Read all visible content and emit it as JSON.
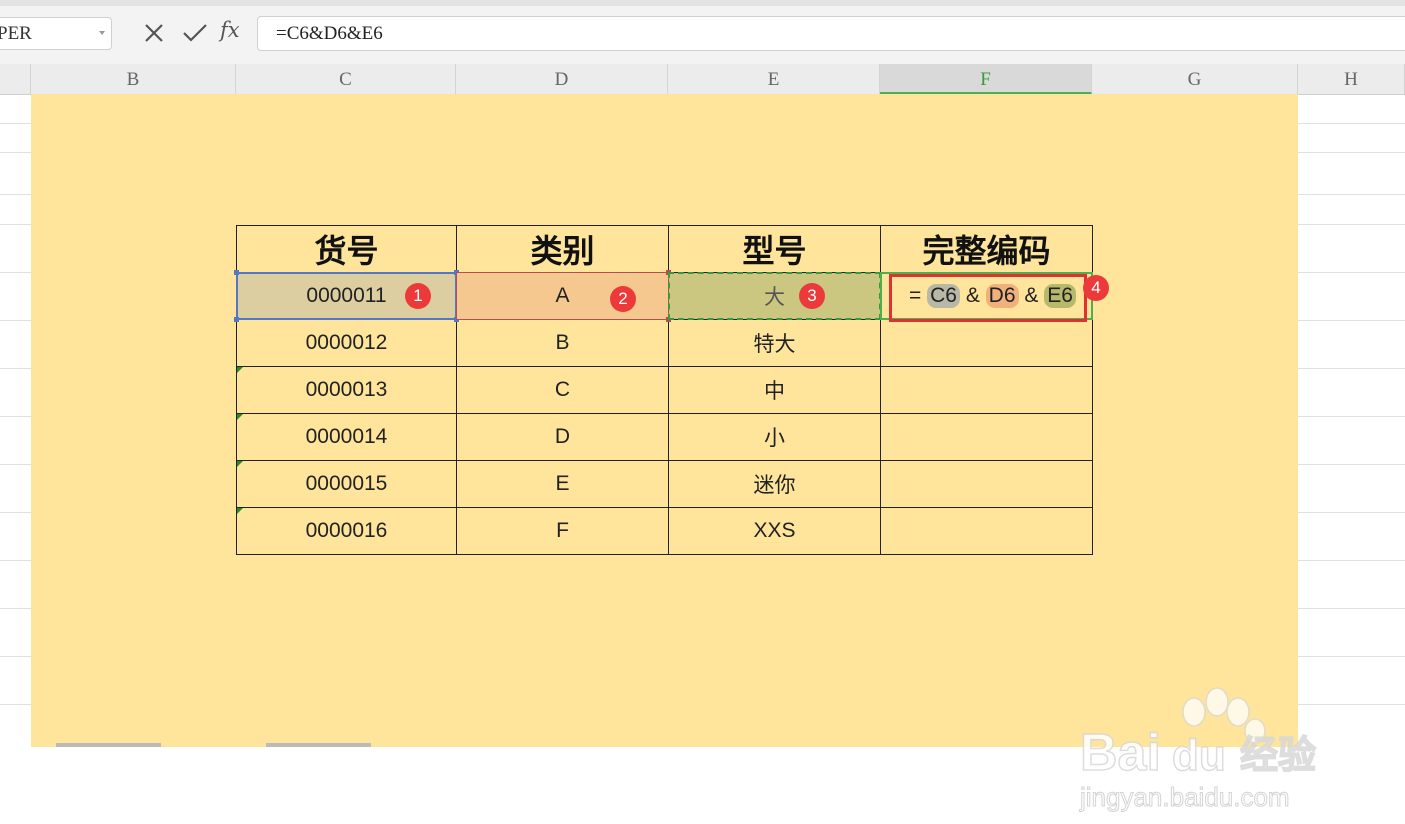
{
  "formula_bar": {
    "name_box": "PER",
    "cancel_icon": "x-icon",
    "confirm_icon": "check-icon",
    "fx_label": "fx",
    "formula": "=C6&D6&E6"
  },
  "columns": [
    "B",
    "C",
    "D",
    "E",
    "F",
    "G",
    "H"
  ],
  "active_column": "F",
  "table": {
    "headers": [
      "货号",
      "类别",
      "型号",
      "完整编码"
    ],
    "rows": [
      [
        "0000011",
        "A",
        "大",
        ""
      ],
      [
        "0000012",
        "B",
        "特大",
        ""
      ],
      [
        "0000013",
        "C",
        "中",
        ""
      ],
      [
        "0000014",
        "D",
        "小",
        ""
      ],
      [
        "0000015",
        "E",
        "迷你",
        ""
      ],
      [
        "0000016",
        "F",
        "XXS",
        ""
      ]
    ]
  },
  "editing_formula": {
    "eq": "=",
    "ref1": "C6",
    "amp1": "&",
    "ref2": "D6",
    "amp2": "&",
    "ref3": "E6"
  },
  "badges": [
    "1",
    "2",
    "3",
    "4"
  ],
  "watermark": {
    "brand": "Bai",
    "brand2": "du",
    "brand_cn": "经验",
    "url": "jingyan.baidu.com"
  },
  "colors": {
    "sheet_highlight": "#fee59b",
    "badge": "#ec3a3a",
    "c6_fill": "#dccea0",
    "d6_fill": "#f4c88e",
    "e6_fill": "#cbc680"
  }
}
